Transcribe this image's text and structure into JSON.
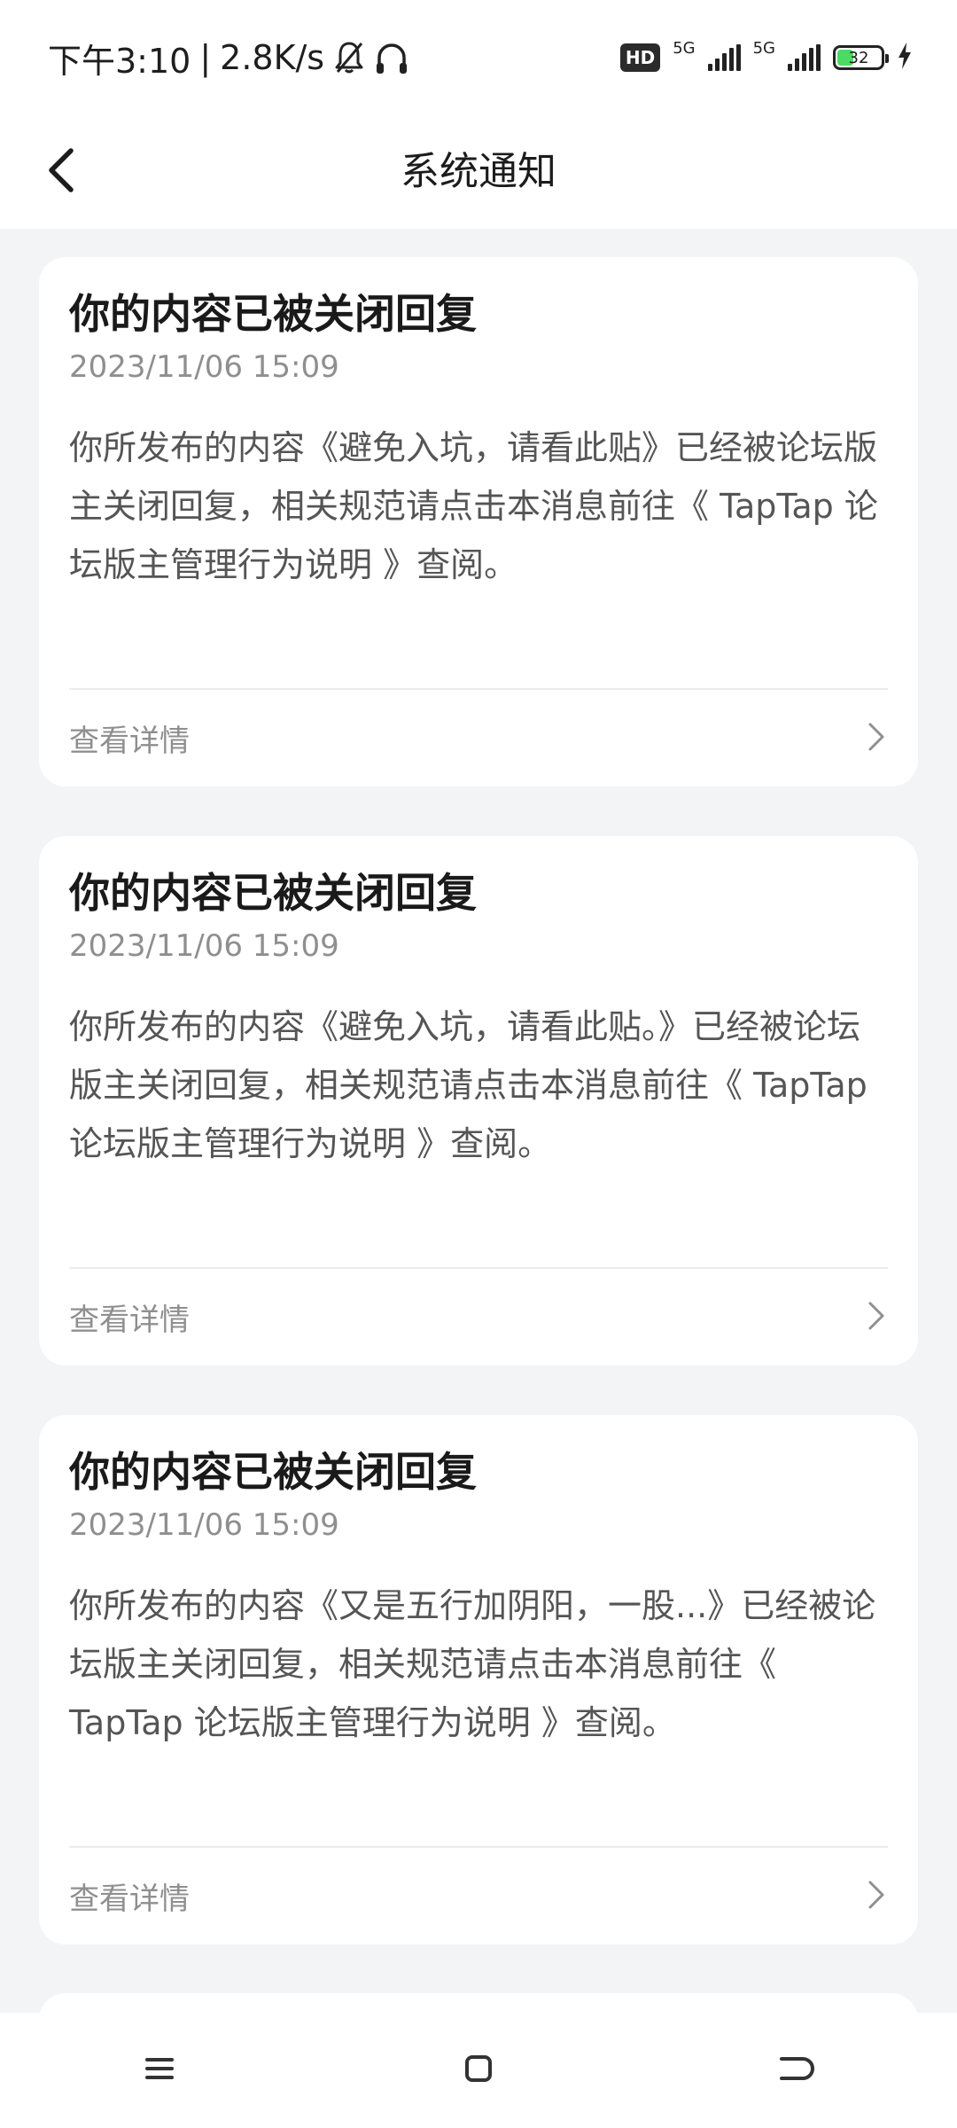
{
  "status_bar": {
    "time": "下午3:10",
    "separator": "|",
    "speed": "2.8K/s",
    "hd_label": "HD",
    "net1": "5G",
    "net2": "5G",
    "battery_level": "32",
    "battery_color": "#4cd964"
  },
  "header": {
    "title": "系统通知",
    "back_icon": "chevron-left-icon"
  },
  "notifications": [
    {
      "title": "你的内容已被关闭回复",
      "time": "2023/11/06 15:09",
      "body": "你所发布的内容《避免入坑，请看此贴》已经被论坛版主关闭回复，相关规范请点击本消息前往《 TapTap 论坛版主管理行为说明 》查阅。",
      "action": "查看详情"
    },
    {
      "title": "你的内容已被关闭回复",
      "time": "2023/11/06 15:09",
      "body": "你所发布的内容《避免入坑，请看此贴。》已经被论坛版主关闭回复，相关规范请点击本消息前往《 TapTap 论坛版主管理行为说明 》查阅。",
      "action": "查看详情"
    },
    {
      "title": "你的内容已被关闭回复",
      "time": "2023/11/06 15:09",
      "body": "你所发布的内容《又是五行加阴阳，一股...》已经被论坛版主关闭回复，相关规范请点击本消息前往《 TapTap 论坛版主管理行为说明 》查阅。",
      "action": "查看详情"
    }
  ],
  "nav_bar": {
    "menu_icon": "menu-icon",
    "home_icon": "home-icon",
    "back_icon": "back-gesture-icon"
  }
}
